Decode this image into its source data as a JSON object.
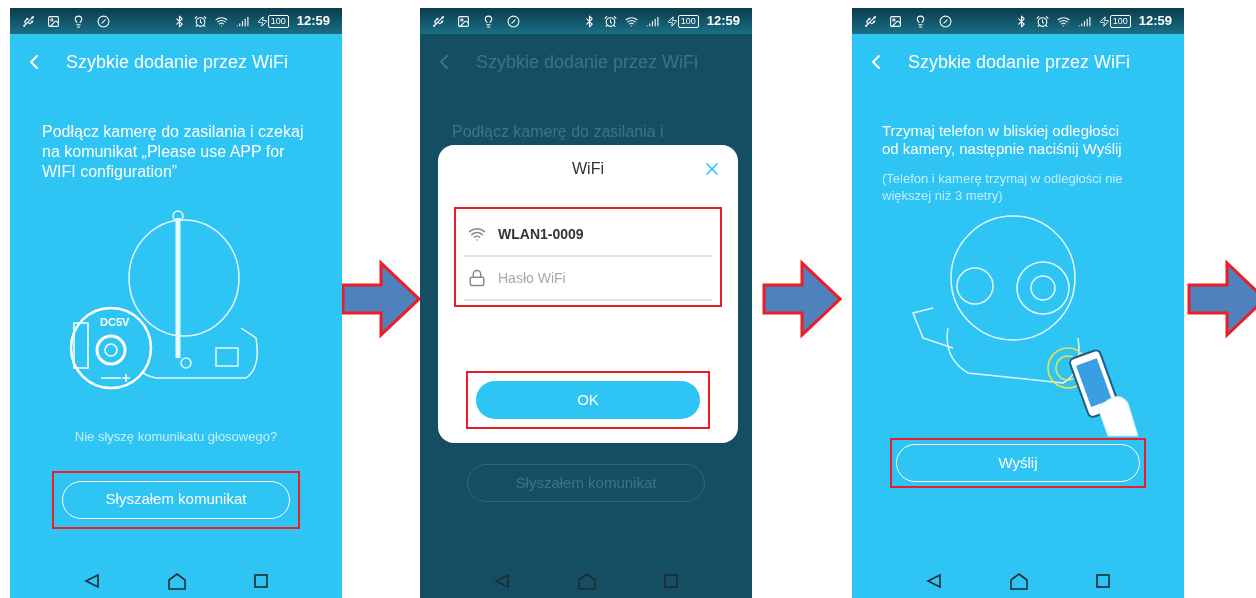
{
  "screens": [
    {
      "kind": "intro",
      "status": {
        "time": "12:59",
        "battery": "100"
      },
      "title": "Szybkie dodanie przez WiFi",
      "dimmed": false,
      "instruction": "Podłącz kamerę do zasilania i czekaj na komunikat „Please use APP for WIFI configuration”",
      "port_label": "DC5V",
      "link": "Nie słyszę komunikatu głosowego?",
      "button": {
        "label": "Słyszałem komunikat",
        "highlighted": true
      }
    },
    {
      "kind": "dialog",
      "status": {
        "time": "12:59",
        "battery": "100"
      },
      "title": "Szybkie dodanie przez WiFi",
      "dimmed": true,
      "instruction": "Podłącz kamerę do zasilania i",
      "button": {
        "label": "Słyszałem komunikat",
        "highlighted": false
      },
      "dialog": {
        "title": "WiFi",
        "fields_highlighted": true,
        "fields": [
          {
            "kind": "network",
            "value": "WLAN1-0009"
          },
          {
            "kind": "password",
            "placeholder": "Hasło WiFi"
          }
        ],
        "ok": {
          "label": "OK",
          "highlighted": true
        }
      }
    },
    {
      "kind": "send",
      "status": {
        "time": "12:59",
        "battery": "100"
      },
      "title": "Szybkie dodanie przez WiFi",
      "dimmed": false,
      "instruction": "Trzymaj telefon w bliskiej odległości od kamery, następnie naciśnij Wyślij",
      "note": "(Telefon i kamerę trzymaj w odległości nie większej niż 3 metry)",
      "button": {
        "label": "Wyślij",
        "highlighted": true
      }
    }
  ]
}
